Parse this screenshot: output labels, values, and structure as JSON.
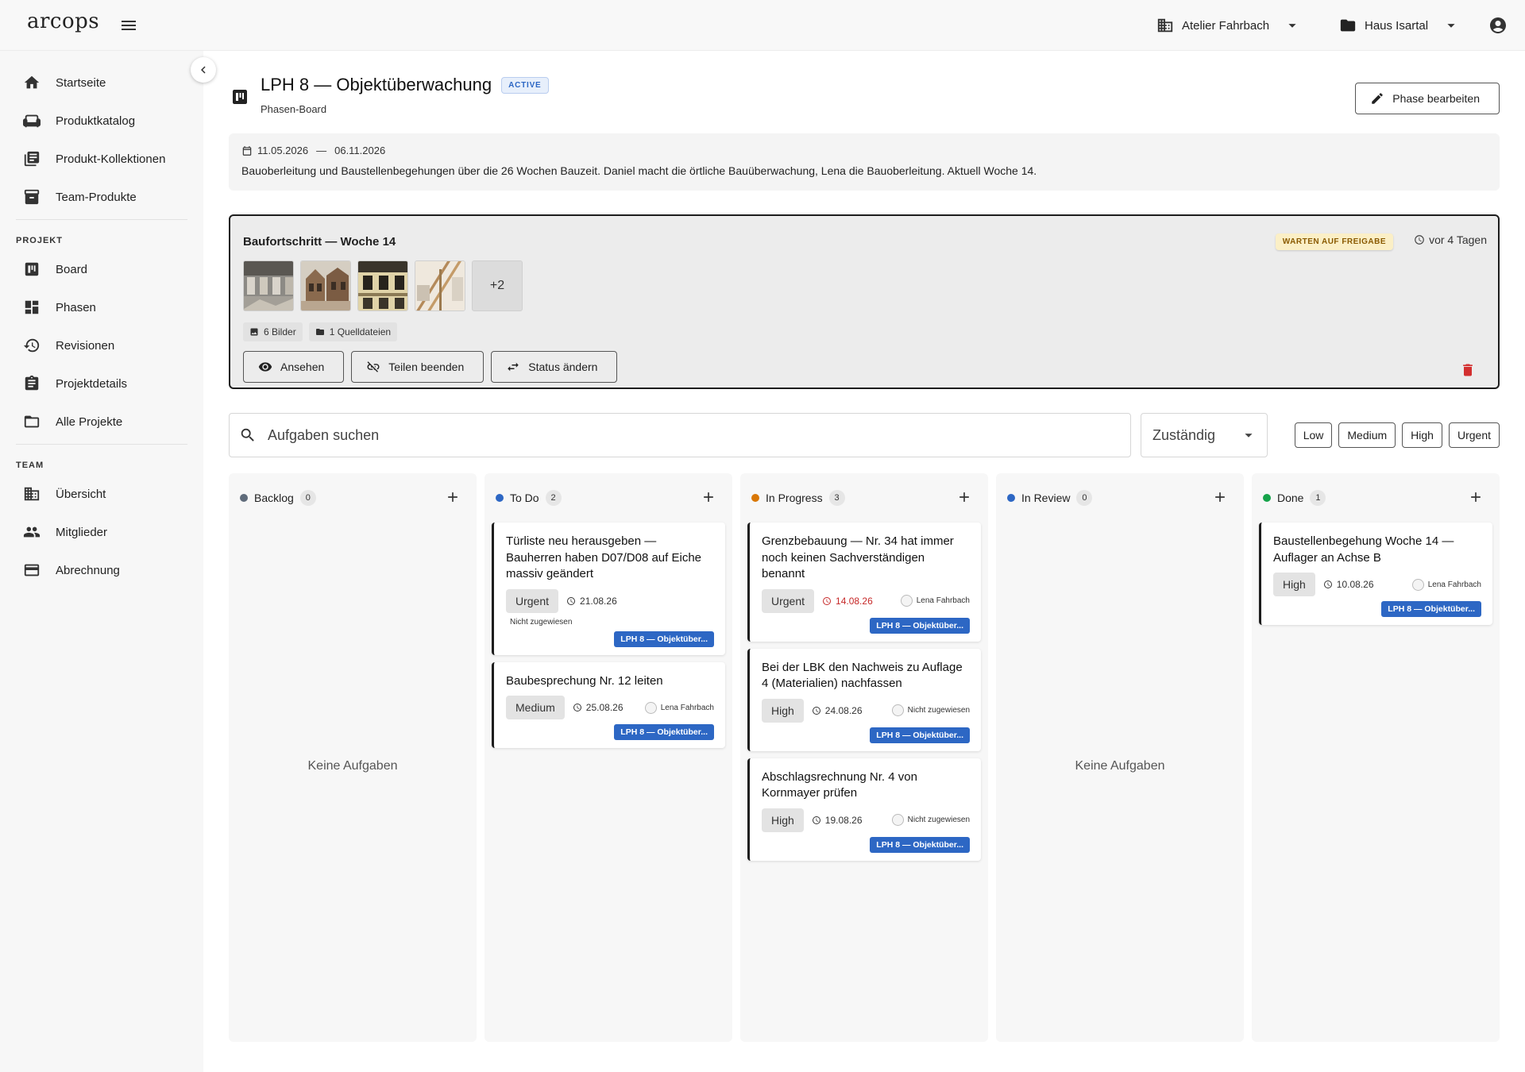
{
  "app": {
    "logo": "arcops"
  },
  "header": {
    "studio": "Atelier Fahrbach",
    "project": "Haus Isartal"
  },
  "sidebar": {
    "main_items": [
      {
        "label": "Startseite",
        "icon": "home-icon"
      },
      {
        "label": "Produktkatalog",
        "icon": "sofa-icon"
      },
      {
        "label": "Produkt-Kollektionen",
        "icon": "library-icon"
      },
      {
        "label": "Team-Produkte",
        "icon": "inventory-icon"
      }
    ],
    "project_section": "PROJEKT",
    "project_items": [
      {
        "label": "Board",
        "icon": "board-icon"
      },
      {
        "label": "Phasen",
        "icon": "dashboard-icon"
      },
      {
        "label": "Revisionen",
        "icon": "history-icon"
      },
      {
        "label": "Projektdetails",
        "icon": "clipboard-icon"
      },
      {
        "label": "Alle Projekte",
        "icon": "folder-icon"
      }
    ],
    "team_section": "TEAM",
    "team_items": [
      {
        "label": "Übersicht",
        "icon": "building-icon"
      },
      {
        "label": "Mitglieder",
        "icon": "people-icon"
      },
      {
        "label": "Abrechnung",
        "icon": "credit-card-icon"
      }
    ]
  },
  "phase": {
    "title": "LPH 8 — Objektüberwachung",
    "badge": "ACTIVE",
    "subtitle": "Phasen-Board",
    "edit_label": "Phase bearbeiten",
    "date_start": "11.05.2026",
    "date_sep": "—",
    "date_end": "06.11.2026",
    "description": "Bauoberleitung und Baustellenbegehungen über die 26 Wochen Bauzeit. Daniel macht die örtliche Bauüberwachung, Lena die Bauoberleitung. Aktuell Woche 14."
  },
  "share": {
    "title": "Baufortschritt — Woche 14",
    "status": "WARTEN AUF FREIGABE",
    "time": "vor 4 Tagen",
    "more": "+2",
    "images": "6 Bilder",
    "sources": "1 Quelldateien",
    "view_label": "Ansehen",
    "stop_label": "Teilen beenden",
    "status_label": "Status ändern"
  },
  "filters": {
    "search_placeholder": "Aufgaben suchen",
    "assignee": "Zuständig",
    "priorities": [
      "Low",
      "Medium",
      "High",
      "Urgent"
    ]
  },
  "board": {
    "empty_text": "Keine Aufgaben",
    "columns": [
      {
        "name": "Backlog",
        "count": "0",
        "color": "#5f6b7a",
        "cards": []
      },
      {
        "name": "To Do",
        "count": "2",
        "color": "#2d67c4",
        "cards": [
          {
            "title": "Türliste neu herausgeben — Bauherren haben D07/D08 auf Eiche massiv geändert",
            "priority": "Urgent",
            "due": "21.08.26",
            "overdue": false,
            "assignee": "Nicht zugewiesen",
            "assignee_wrap": true,
            "phase": "LPH 8 — Objektüber..."
          },
          {
            "title": "Baubesprechung Nr. 12 leiten",
            "priority": "Medium",
            "due": "25.08.26",
            "overdue": false,
            "assignee": "Lena Fahrbach",
            "assignee_wrap": false,
            "phase": "LPH 8 — Objektüber..."
          }
        ]
      },
      {
        "name": "In Progress",
        "count": "3",
        "color": "#d97706",
        "cards": [
          {
            "title": "Grenzbebauung — Nr. 34 hat immer noch keinen Sachverständigen benannt",
            "priority": "Urgent",
            "due": "14.08.26",
            "overdue": true,
            "assignee": "Lena Fahrbach",
            "assignee_wrap": false,
            "phase": "LPH 8 — Objektüber..."
          },
          {
            "title": "Bei der LBK den Nachweis zu Auflage 4 (Materialien) nachfassen",
            "priority": "High",
            "due": "24.08.26",
            "overdue": false,
            "assignee": "Nicht zugewiesen",
            "assignee_wrap": false,
            "phase": "LPH 8 — Objektüber..."
          },
          {
            "title": "Abschlagsrechnung Nr. 4 von Kornmayer prüfen",
            "priority": "High",
            "due": "19.08.26",
            "overdue": false,
            "assignee": "Nicht zugewiesen",
            "assignee_wrap": false,
            "phase": "LPH 8 — Objektüber..."
          }
        ]
      },
      {
        "name": "In Review",
        "count": "0",
        "color": "#2d67c4",
        "cards": []
      },
      {
        "name": "Done",
        "count": "1",
        "color": "#16a34a",
        "cards": [
          {
            "title": "Baustellenbegehung Woche 14 — Auflager an Achse B",
            "priority": "High",
            "due": "10.08.26",
            "overdue": false,
            "assignee": "Lena Fahrbach",
            "assignee_wrap": false,
            "phase": "LPH 8 — Objektüber..."
          }
        ]
      }
    ]
  }
}
